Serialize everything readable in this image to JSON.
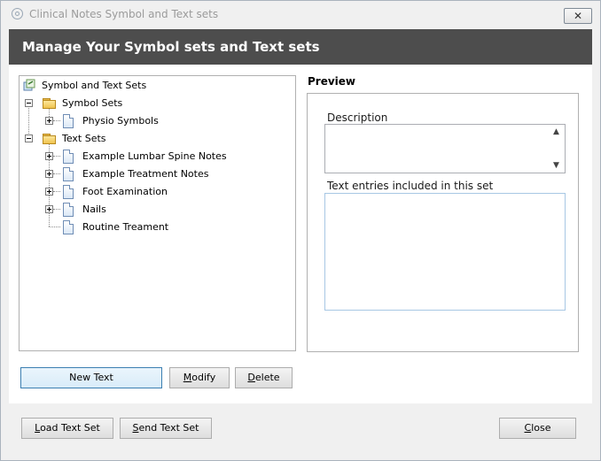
{
  "window": {
    "title": "Clinical Notes Symbol and Text sets",
    "close_glyph": "✕"
  },
  "banner": {
    "title": "Manage Your Symbol sets and Text sets"
  },
  "tree": {
    "root": {
      "label": "Symbol and Text Sets",
      "icon": "sets-root-icon"
    },
    "symbol_sets": {
      "label": "Symbol Sets",
      "expanded": true,
      "items": [
        {
          "label": "Physio Symbols",
          "expandable": true
        }
      ]
    },
    "text_sets": {
      "label": "Text Sets",
      "expanded": true,
      "items": [
        {
          "label": "Example Lumbar Spine Notes",
          "expandable": true
        },
        {
          "label": "Example Treatment Notes",
          "expandable": true
        },
        {
          "label": "Foot Examination",
          "expandable": true
        },
        {
          "label": "Nails",
          "expandable": true
        },
        {
          "label": "Routine Treament",
          "expandable": false
        }
      ]
    }
  },
  "preview": {
    "heading": "Preview",
    "description_label": "Description",
    "description_value": "",
    "entries_label": "Text entries included in this set",
    "entries_value": ""
  },
  "actions": {
    "new_text": "New Text",
    "modify_first": "M",
    "modify_rest": "odify",
    "delete_first": "D",
    "delete_rest": "elete"
  },
  "footer": {
    "load_first": "L",
    "load_rest": "oad Text Set",
    "send_first": "S",
    "send_rest": "end Text Set",
    "close_first": "C",
    "close_rest": "lose"
  },
  "colors": {
    "banner": "#4d4d4d",
    "focus_border": "#3c7fb1",
    "folder": "#efc44f"
  }
}
